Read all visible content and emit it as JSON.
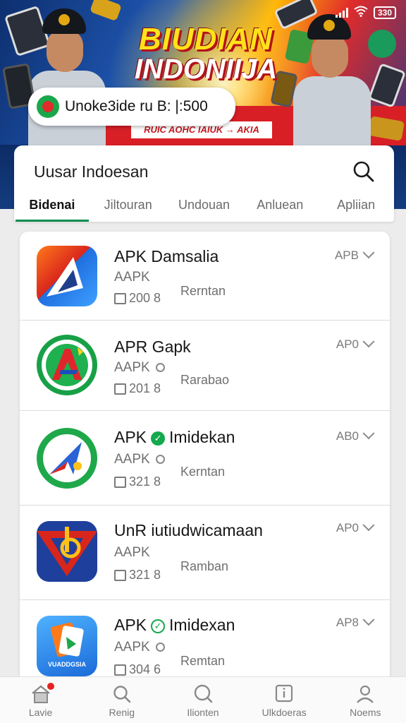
{
  "status_bar": {
    "battery": "330"
  },
  "banner": {
    "title_line1": "BIUDIAN",
    "title_line2": "INDONIIJA",
    "subtitle": "RUIC AOHC IAIUK → AKIA",
    "promo_text": "Unoke3ide ru B:  |:500"
  },
  "header": {
    "title": "Uusar Indoesan",
    "tabs": [
      {
        "label": "Bidenai"
      },
      {
        "label": "Jiltouran"
      },
      {
        "label": "Undouan"
      },
      {
        "label": "Anluean"
      },
      {
        "label": "Apliian"
      }
    ]
  },
  "apps": [
    {
      "name": "APK Damsalia",
      "sub": "AAPK",
      "size": "200 8",
      "status": "Rerntan",
      "tag": "APB",
      "icon": "app-icon-red-blue-a"
    },
    {
      "name": "APR Gapk",
      "sub": "AAPK",
      "size": "201 8",
      "status": "Rarabao",
      "tag": "AP0",
      "icon": "app-icon-green-a"
    },
    {
      "name_prefix": "APK",
      "name": "Imidekan",
      "sub": "AAPK",
      "size": "321 8",
      "status": "Kerntan",
      "tag": "AB0",
      "icon": "app-icon-green-plane"
    },
    {
      "name": "UnR iutiudwicamaan",
      "sub": "AAPK",
      "size": "321 8",
      "status": "Ramban",
      "tag": "AP0",
      "icon": "app-icon-red-blue-b"
    },
    {
      "name_prefix": "APK",
      "name": "Imidexan",
      "sub": "AAPK",
      "size": "304 6",
      "status": "Remtan",
      "tag": "AP8",
      "icon": "app-icon-blue-card",
      "icon_text": "VUADDGSIA"
    }
  ],
  "bottom_nav": [
    {
      "label": "Lavie",
      "icon": "home-icon"
    },
    {
      "label": "Renig",
      "icon": "search-icon"
    },
    {
      "label": "Ilionten",
      "icon": "search-icon"
    },
    {
      "label": "Ulkdoeras",
      "icon": "info-icon"
    },
    {
      "label": "Noems",
      "icon": "profile-icon"
    }
  ],
  "colors": {
    "accent": "#0a8f52",
    "brand_red": "#d81f26",
    "brand_blue": "#1f57b3",
    "notify_dot": "#e52222"
  }
}
